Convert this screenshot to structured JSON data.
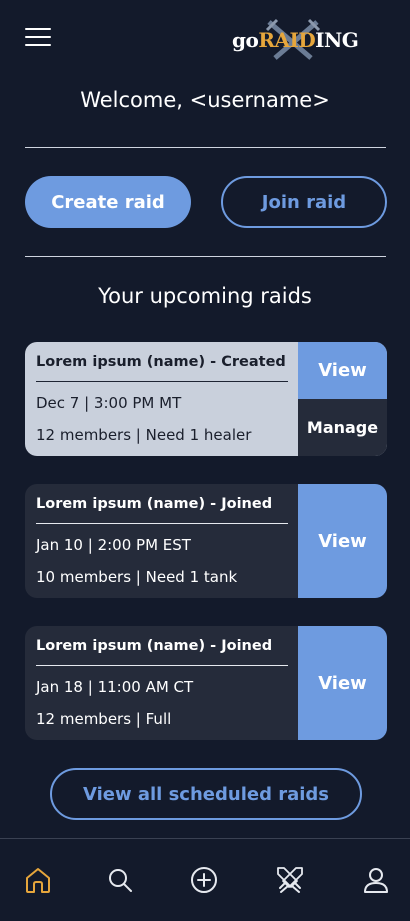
{
  "header": {
    "logo_prefix": "go",
    "logo_accent": "RAID",
    "logo_suffix": "ING",
    "menu_icon": "hamburger-icon"
  },
  "welcome": "Welcome, <username>",
  "actions": {
    "create_label": "Create raid",
    "join_label": "Join raid"
  },
  "section_title": "Your upcoming raids",
  "raids": [
    {
      "title": "Lorem ipsum (name) - Created",
      "date_time": "Dec 7 | 3:00 PM MT",
      "status": "12 members | Need 1 healer",
      "view_label": "View",
      "manage_label": "Manage"
    },
    {
      "title": "Lorem ipsum (name) - Joined",
      "date_time": "Jan 10 | 2:00 PM EST",
      "status": "10 members | Need 1 tank",
      "view_label": "View"
    },
    {
      "title": "Lorem ipsum (name) - Joined",
      "date_time": "Jan 18 | 11:00 AM CT",
      "status": "12 members | Full",
      "view_label": "View"
    }
  ],
  "view_all_label": "View all scheduled raids",
  "bottom_nav": [
    {
      "icon": "home-icon",
      "active": true
    },
    {
      "icon": "search-icon",
      "active": false
    },
    {
      "icon": "add-circle-icon",
      "active": false
    },
    {
      "icon": "crossed-swords-icon",
      "active": false
    },
    {
      "icon": "profile-icon",
      "active": false
    }
  ],
  "colors": {
    "background": "#131a2b",
    "accent": "#6e9be0",
    "active_nav": "#e6a63c",
    "card_dark": "#252b3a",
    "card_light": "#c9d0dc"
  }
}
